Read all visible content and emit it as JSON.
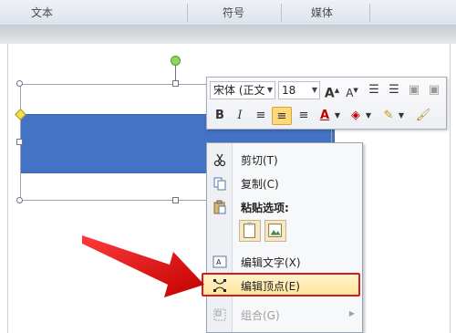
{
  "ribbon": {
    "groups": [
      "文本",
      "符号",
      "媒体"
    ]
  },
  "mini_toolbar": {
    "font_name": "宋体 (正文",
    "font_size": "18",
    "buttons": [
      "A",
      "A",
      "B",
      "I",
      "A"
    ]
  },
  "context_menu": {
    "items": [
      {
        "label": "剪切(T)",
        "enabled": true
      },
      {
        "label": "复制(C)",
        "enabled": true
      },
      {
        "label": "粘贴选项:",
        "enabled": true
      },
      {
        "label": "编辑文字(X)",
        "enabled": true
      },
      {
        "label": "编辑顶点(E)",
        "enabled": true,
        "highlighted": true
      },
      {
        "label": "组合(G)",
        "enabled": false
      }
    ]
  },
  "colors": {
    "shape_fill": "#4472c4",
    "highlight_border": "#d11d1d",
    "arrow": "#e01010"
  }
}
